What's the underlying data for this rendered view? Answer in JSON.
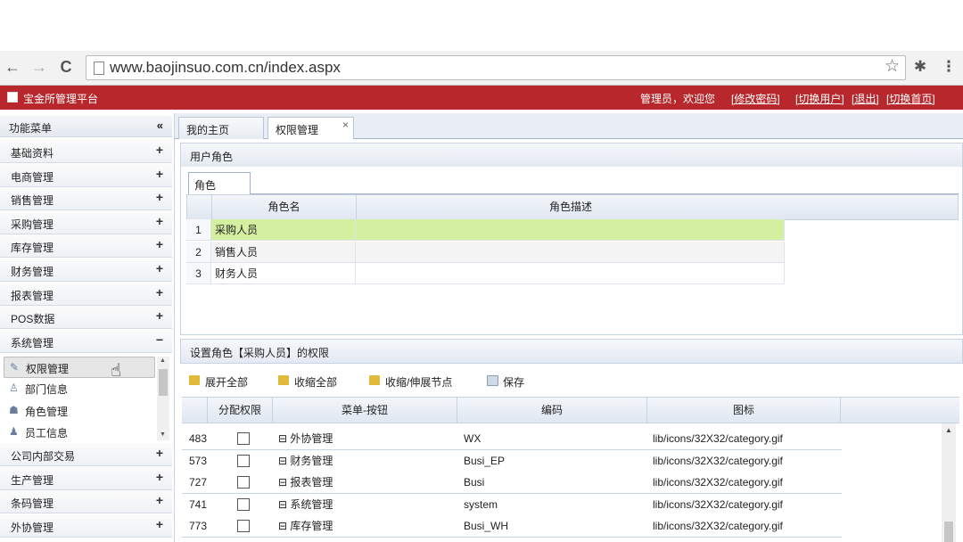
{
  "browser": {
    "back": "←",
    "forward": "→",
    "reload": "C",
    "url": "www.baojinsuo.com.cn/index.aspx",
    "star": "☆",
    "puzzle": "✱",
    "menu": "⋮"
  },
  "header": {
    "title": "宝金所管理平台",
    "welcome": "管理员，欢迎您",
    "links": [
      "[修改密码]",
      "[切换用户]",
      "[退出]",
      "[切换首页]"
    ],
    "brand_color": "#b8272b"
  },
  "sidebar": {
    "head_label": "功能菜单",
    "head_ctl": "«",
    "items_top": [
      {
        "label": "基础资料",
        "ctl": "+"
      },
      {
        "label": "电商管理",
        "ctl": "+"
      },
      {
        "label": "销售管理",
        "ctl": "+"
      },
      {
        "label": "采购管理",
        "ctl": "+"
      },
      {
        "label": "库存管理",
        "ctl": "+"
      },
      {
        "label": "财务管理",
        "ctl": "+"
      },
      {
        "label": "报表管理",
        "ctl": "+"
      },
      {
        "label": "POS数据",
        "ctl": "+"
      },
      {
        "label": "系统管理",
        "ctl": "−"
      }
    ],
    "sub_items": [
      {
        "label": "权限管理",
        "icon": "✎"
      },
      {
        "label": "部门信息",
        "icon": "♙"
      },
      {
        "label": "角色管理",
        "icon": "☗"
      },
      {
        "label": "员工信息",
        "icon": "♟"
      }
    ],
    "items_bottom": [
      {
        "label": "公司内部交易",
        "ctl": "+"
      },
      {
        "label": "生产管理",
        "ctl": "+"
      },
      {
        "label": "条码管理",
        "ctl": "+"
      },
      {
        "label": "外协管理",
        "ctl": "+"
      }
    ]
  },
  "tabs": [
    {
      "label": "我的主页"
    },
    {
      "label": "权限管理",
      "close": "×"
    }
  ],
  "roles_panel": {
    "title": "用户角色",
    "inner_tab": "角色",
    "columns": [
      "角色名",
      "角色描述"
    ],
    "rows": [
      {
        "n": "1",
        "name": "采购人员",
        "desc": ""
      },
      {
        "n": "2",
        "name": "销售人员",
        "desc": ""
      },
      {
        "n": "3",
        "name": "财务人员",
        "desc": ""
      }
    ],
    "selected_color": "#d4efa0"
  },
  "perm_panel": {
    "title": "设置角色【采购人员】的权限",
    "toolbar": [
      "展开全部",
      "收缩全部",
      "收缩/伸展节点",
      "保存"
    ],
    "columns": [
      "分配权限",
      "菜单-按钮",
      "编码",
      "图标"
    ],
    "rows": [
      {
        "id": "483",
        "menu": "⊟ 外协管理",
        "code": "WX",
        "icon": "lib/icons/32X32/category.gif"
      },
      {
        "id": "573",
        "menu": "⊟ 财务管理",
        "code": "Busi_EP",
        "icon": "lib/icons/32X32/category.gif"
      },
      {
        "id": "727",
        "menu": "⊟ 报表管理",
        "code": "Busi",
        "icon": "lib/icons/32X32/category.gif"
      },
      {
        "id": "741",
        "menu": "⊟ 系统管理",
        "code": "system",
        "icon": "lib/icons/32X32/category.gif"
      },
      {
        "id": "773",
        "menu": "⊟ 库存管理",
        "code": "Busi_WH",
        "icon": "lib/icons/32X32/category.gif"
      }
    ]
  }
}
